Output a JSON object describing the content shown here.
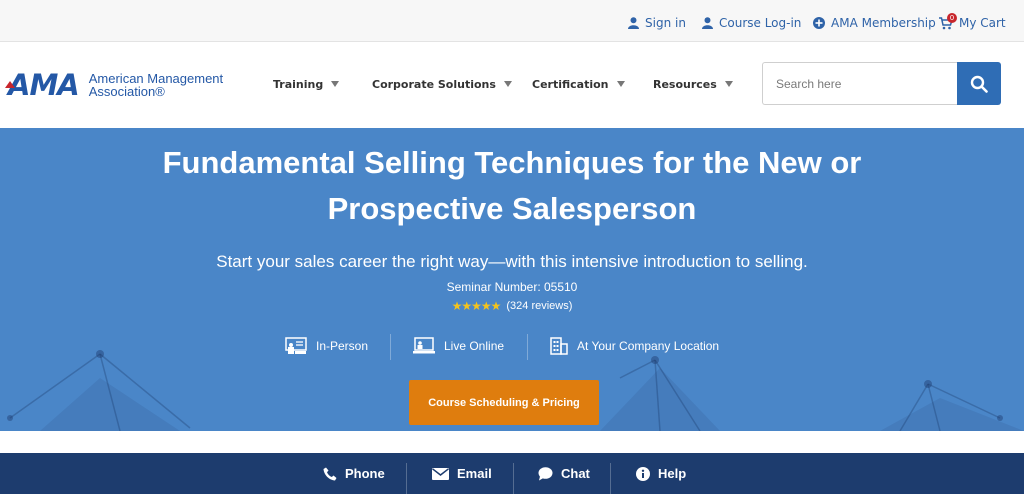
{
  "utility": {
    "sign_in": "Sign in",
    "course_login": "Course Log-in",
    "membership": "AMA Membership",
    "cart": "My Cart",
    "cart_count": "0"
  },
  "logo": {
    "mark": "AMA",
    "line1": "American Management",
    "line2": "Association®"
  },
  "nav": {
    "items": [
      "Training",
      "Corporate Solutions",
      "Certification",
      "Resources"
    ]
  },
  "search": {
    "placeholder": "Search here"
  },
  "hero": {
    "title_line1": "Fundamental Selling Techniques for the New or",
    "title_line2": "Prospective Salesperson",
    "subtitle": "Start your sales career the right way—with this intensive introduction to selling.",
    "seminar_number": "Seminar Number: 05510",
    "stars": "★★★★★",
    "rating_fraction": 1.0,
    "reviews": "(324 reviews)",
    "formats": [
      "In-Person",
      "Live Online",
      "At Your Company Location"
    ],
    "cta": "Course Scheduling & Pricing"
  },
  "contact": {
    "items": [
      "Phone",
      "Email",
      "Chat",
      "Help"
    ]
  },
  "colors": {
    "brand_blue": "#2458a6",
    "hero_blue": "#4a86c8",
    "cta_orange": "#df7d0e",
    "footer_navy": "#1d3c6e",
    "logo_red": "#c8262c"
  }
}
